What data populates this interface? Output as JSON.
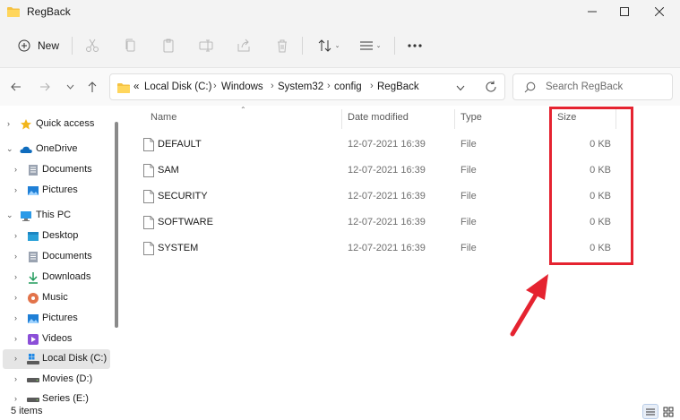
{
  "window": {
    "title": "RegBack"
  },
  "toolbar": {
    "new_label": "New"
  },
  "address": {
    "prefix": "«",
    "crumbs": [
      "Local Disk (C:)",
      "Windows",
      "System32",
      "config",
      "RegBack"
    ]
  },
  "search": {
    "placeholder": "Search RegBack"
  },
  "sidebar": {
    "items": [
      {
        "label": "Quick access"
      },
      {
        "label": "OneDrive"
      },
      {
        "label": "Documents"
      },
      {
        "label": "Pictures"
      },
      {
        "label": "This PC"
      },
      {
        "label": "Desktop"
      },
      {
        "label": "Documents"
      },
      {
        "label": "Downloads"
      },
      {
        "label": "Music"
      },
      {
        "label": "Pictures"
      },
      {
        "label": "Videos"
      },
      {
        "label": "Local Disk (C:)"
      },
      {
        "label": "Movies (D:)"
      },
      {
        "label": "Series (E:)"
      }
    ]
  },
  "columns": {
    "name": "Name",
    "date": "Date modified",
    "type": "Type",
    "size": "Size"
  },
  "files": [
    {
      "name": "DEFAULT",
      "date": "12-07-2021 16:39",
      "type": "File",
      "size": "0 KB"
    },
    {
      "name": "SAM",
      "date": "12-07-2021 16:39",
      "type": "File",
      "size": "0 KB"
    },
    {
      "name": "SECURITY",
      "date": "12-07-2021 16:39",
      "type": "File",
      "size": "0 KB"
    },
    {
      "name": "SOFTWARE",
      "date": "12-07-2021 16:39",
      "type": "File",
      "size": "0 KB"
    },
    {
      "name": "SYSTEM",
      "date": "12-07-2021 16:39",
      "type": "File",
      "size": "0 KB"
    }
  ],
  "status": {
    "count": "5 items"
  },
  "colors": {
    "accent": "#0067c0",
    "highlight": "#e52330",
    "folder": "#f5c242"
  }
}
